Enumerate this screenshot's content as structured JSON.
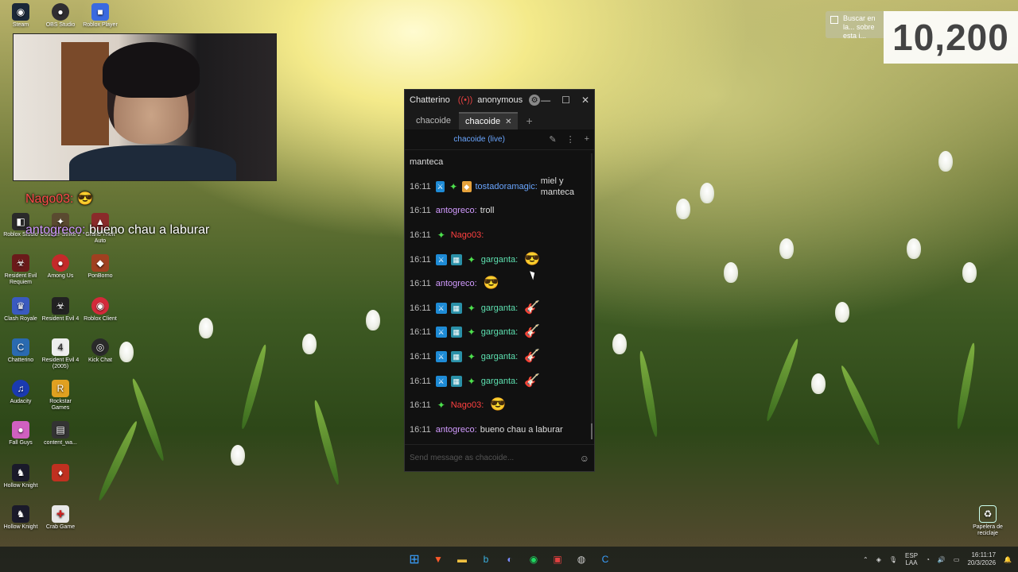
{
  "desktop": {
    "icons": [
      {
        "label": "Steam"
      },
      {
        "label": "OBS Studio"
      },
      {
        "label": "Roblox Player"
      },
      {
        "label": "Roblox Studio"
      },
      {
        "label": "Counter-Strike 2"
      },
      {
        "label": "Grand Theft Auto"
      },
      {
        "label": "Resident Evil Requiem"
      },
      {
        "label": "Among Us"
      },
      {
        "label": "PonBorno"
      },
      {
        "label": "Clash Royale"
      },
      {
        "label": "Resident Evil 4"
      },
      {
        "label": "Roblox Client"
      },
      {
        "label": "Chatterino"
      },
      {
        "label": "Resident Evil 4 (2005)"
      },
      {
        "label": "Kick Chat"
      },
      {
        "label": "Audacity"
      },
      {
        "label": "Rockstar Games"
      },
      {
        "label": "Fall Guys"
      },
      {
        "label": "content_wa..."
      },
      {
        "label": "Hollow Knight"
      },
      {
        "label": "Hollow Knight"
      },
      {
        "label": "Crab Game"
      },
      {
        "label": "Papelera de reciclaje"
      }
    ],
    "overlay_chat": [
      {
        "name": "Nago03:",
        "text": ""
      },
      {
        "name": "antogreco:",
        "text": "bueno chau a laburar"
      }
    ],
    "search_hint": "Buscar en la... sobre esta i...",
    "counter": "10,200"
  },
  "chat": {
    "app_title": "Chatterino",
    "account": "anonymous",
    "tabs": [
      {
        "label": "chacoide",
        "active": false
      },
      {
        "label": "chacoide",
        "active": true
      }
    ],
    "channel_header": "chacoide (live)",
    "input_placeholder": "Send message as chacoide...",
    "messages": [
      {
        "time": "",
        "badges": [],
        "name": "",
        "color": "#ddd",
        "text": "manteca",
        "emote": ""
      },
      {
        "time": "16:11",
        "badges": [
          "mod",
          "vip",
          "gift"
        ],
        "name": "tostadoramagic:",
        "color": "#6aa6ff",
        "text": "miel y manteca",
        "emote": ""
      },
      {
        "time": "16:11",
        "badges": [],
        "name": "antogreco:",
        "color": "#d29bff",
        "text": "troll",
        "emote": ""
      },
      {
        "time": "16:11",
        "badges": [
          "vip"
        ],
        "name": "Nago03:",
        "color": "#ff4040",
        "text": "",
        "emote": ""
      },
      {
        "time": "16:11",
        "badges": [
          "mod",
          "sub",
          "vip"
        ],
        "name": "garganta:",
        "color": "#5de0b0",
        "text": "",
        "emote": "😎"
      },
      {
        "time": "16:11",
        "badges": [],
        "name": "antogreco:",
        "color": "#d29bff",
        "text": "",
        "emote": "😎"
      },
      {
        "time": "16:11",
        "badges": [
          "mod",
          "sub",
          "vip"
        ],
        "name": "garganta:",
        "color": "#5de0b0",
        "text": "",
        "emote": "🎸"
      },
      {
        "time": "16:11",
        "badges": [
          "mod",
          "sub",
          "vip"
        ],
        "name": "garganta:",
        "color": "#5de0b0",
        "text": "",
        "emote": "🎸"
      },
      {
        "time": "16:11",
        "badges": [
          "mod",
          "sub",
          "vip"
        ],
        "name": "garganta:",
        "color": "#5de0b0",
        "text": "",
        "emote": "🎸"
      },
      {
        "time": "16:11",
        "badges": [
          "mod",
          "sub",
          "vip"
        ],
        "name": "garganta:",
        "color": "#5de0b0",
        "text": "",
        "emote": "🎸"
      },
      {
        "time": "16:11",
        "badges": [
          "vip"
        ],
        "name": "Nago03:",
        "color": "#ff4040",
        "text": "",
        "emote": "😎"
      },
      {
        "time": "16:11",
        "badges": [],
        "name": "antogreco:",
        "color": "#d29bff",
        "text": "bueno chau a laburar",
        "emote": ""
      }
    ]
  },
  "taskbar": {
    "apps": [
      {
        "icon": "windows-start-icon"
      },
      {
        "icon": "brave-icon"
      },
      {
        "icon": "file-explorer-icon"
      },
      {
        "icon": "bing-icon"
      },
      {
        "icon": "discord-icon"
      },
      {
        "icon": "spotify-icon"
      },
      {
        "icon": "game-icon"
      },
      {
        "icon": "obs-icon"
      },
      {
        "icon": "chatterino-icon"
      }
    ],
    "lang": "ESP",
    "lang2": "LAA",
    "time": "16:11:17",
    "date": "20/3/2026"
  }
}
